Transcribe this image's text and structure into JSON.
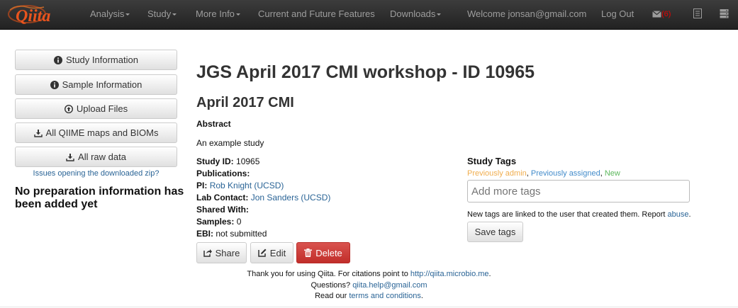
{
  "navbar": {
    "logo_text": "Qiita",
    "items": [
      {
        "label": "Analysis",
        "dropdown": true
      },
      {
        "label": "Study",
        "dropdown": true
      },
      {
        "label": "More Info",
        "dropdown": true
      },
      {
        "label": "Current and Future Features",
        "dropdown": false
      },
      {
        "label": "Downloads",
        "dropdown": true
      }
    ],
    "welcome": "Welcome jonsan@gmail.com",
    "logout": "Log Out",
    "mail_count": "(6)",
    "icons": [
      "envelope-icon",
      "list-icon",
      "server-icon"
    ]
  },
  "sidebar": {
    "buttons": [
      {
        "label": "Study Information",
        "icon": "info-sign-icon"
      },
      {
        "label": "Sample Information",
        "icon": "info-sign-icon"
      },
      {
        "label": "Upload Files",
        "icon": "upload-icon"
      },
      {
        "label": "All QIIME maps and BIOMs",
        "icon": "download-icon"
      },
      {
        "label": "All raw data",
        "icon": "download-icon"
      }
    ],
    "zip_link": "Issues opening the downloaded zip?",
    "no_prep_message": "No preparation information has been added yet"
  },
  "study": {
    "title": "JGS April 2017 CMI workshop - ID 10965",
    "alias": "April 2017 CMI",
    "abstract_label": "Abstract",
    "abstract": "An example study",
    "fields": {
      "study_id": {
        "label": "Study ID:",
        "value": "10965"
      },
      "publications": {
        "label": "Publications:",
        "value": ""
      },
      "pi": {
        "label": "PI:",
        "value": "Rob Knight (UCSD)"
      },
      "lab_contact": {
        "label": "Lab Contact:",
        "value": "Jon Sanders (UCSD)"
      },
      "shared_with": {
        "label": "Shared With:",
        "value": ""
      },
      "samples": {
        "label": "Samples:",
        "value": "0"
      },
      "ebi": {
        "label": "EBI:",
        "value": "not submitted"
      }
    },
    "actions": {
      "share": "Share",
      "edit": "Edit",
      "delete": "Delete"
    }
  },
  "tags": {
    "title": "Study Tags",
    "legend": {
      "admin": "Previously admin",
      "assigned": "Previously assigned",
      "new": "New",
      "sep": ", "
    },
    "legend_colors": {
      "admin": "#f0ad4e",
      "assigned": "#428bca",
      "new": "#5cb85c"
    },
    "input_placeholder": "Add more tags",
    "note_prefix": "New tags are linked to the user that created them. Report ",
    "note_link": "abuse",
    "note_suffix": ".",
    "save_button": "Save tags"
  },
  "footer": {
    "line1_prefix": "Thank you for using Qiita. For citations point to ",
    "line1_link": "http://qiita.microbio.me",
    "line1_suffix": ".",
    "line2_prefix": "Questions? ",
    "line2_link": "qiita.help@gmail.com",
    "line3_prefix": "Read our ",
    "line3_link": "terms and conditions",
    "line3_suffix": "."
  },
  "colors": {
    "navbar_bg": "#222222",
    "nav_text": "#9d9d9d",
    "link": "#2a6496",
    "danger": "#d9534f",
    "mail_count": "#e60000"
  }
}
